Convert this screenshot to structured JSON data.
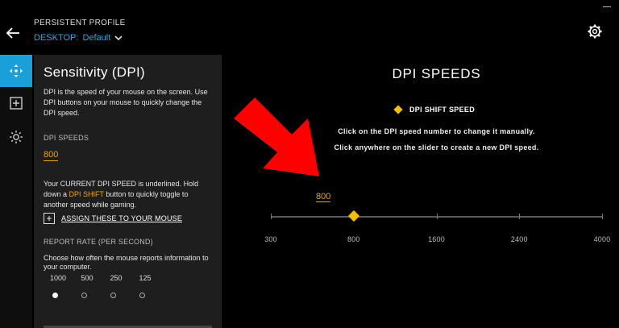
{
  "header": {
    "profile_title": "PERSISTENT PROFILE",
    "profile_prefix": "DESKTOP:",
    "profile_value": "Default"
  },
  "icons": {
    "back": "back-arrow-icon",
    "settings": "gear-icon",
    "dropdown": "chevron-down-icon",
    "rail": [
      "move-icon",
      "add-box-icon",
      "lighting-icon"
    ]
  },
  "panel": {
    "title": "Sensitivity (DPI)",
    "description": "DPI is the speed of your mouse on the screen. Use DPI buttons on your mouse to quickly change the DPI speed.",
    "dpi_speeds_label": "DPI SPEEDS",
    "dpi_value": "800",
    "current_note_1": "Your CURRENT DPI SPEED is underlined. Hold down a ",
    "current_note_hl": "DPI SHIFT",
    "current_note_2": " button to quickly toggle to another speed while gaming.",
    "assign_label": "ASSIGN THESE TO YOUR MOUSE",
    "report_rate_label": "REPORT RATE (PER SECOND)",
    "report_rate_desc": "Choose how often the mouse reports information to your computer.",
    "rates": [
      "1000",
      "500",
      "250",
      "125"
    ],
    "selected_rate": "1000"
  },
  "main": {
    "title": "DPI SPEEDS",
    "shift_legend": "DPI SHIFT SPEED",
    "hint_1": "Click on the DPI speed number to change it manually.",
    "hint_2": "Click anywhere on the slider to create a new DPI speed.",
    "current_dpi": "800",
    "slider": {
      "min": 300,
      "max": 4000,
      "ticks": [
        "300",
        "800",
        "1600",
        "2400",
        "4000"
      ],
      "tick_values": [
        300,
        800,
        1600,
        2400,
        4000
      ],
      "marker_value": 800
    }
  },
  "colors": {
    "accent": "#1a9fd9",
    "highlight": "#f0a30a",
    "marker": "#f0c000",
    "annotation_arrow": "#ff0000"
  }
}
